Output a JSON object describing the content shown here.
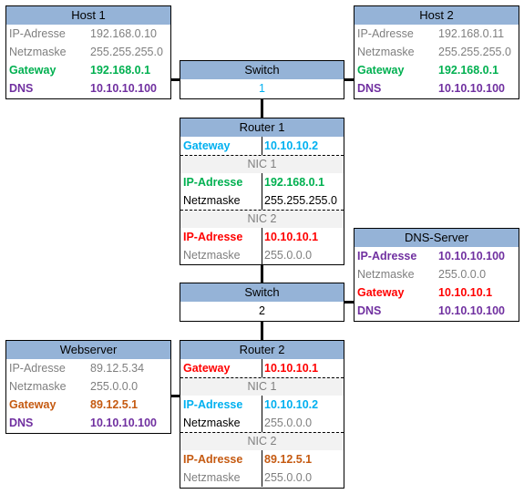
{
  "colors": {
    "gray": "#7f7f7f",
    "black": "#000000",
    "green": "#00b050",
    "purple": "#7030a0",
    "blue": "#00b0f0",
    "red": "#ff0000",
    "orange": "#c55a11",
    "header": "#95b3d7"
  },
  "hosts": [
    {
      "id": "host1",
      "title": "Host 1",
      "rows": [
        {
          "label": "IP-Adresse",
          "value": "192.168.0.10",
          "color": "gray",
          "bold": false
        },
        {
          "label": "Netzmaske",
          "value": "255.255.255.0",
          "color": "gray",
          "bold": false
        },
        {
          "label": "Gateway",
          "value": "192.168.0.1",
          "color": "green",
          "bold": true
        },
        {
          "label": "DNS",
          "value": "10.10.10.100",
          "color": "purple",
          "bold": true
        }
      ]
    },
    {
      "id": "host2",
      "title": "Host 2",
      "rows": [
        {
          "label": "IP-Adresse",
          "value": "192.168.0.11",
          "color": "gray",
          "bold": false
        },
        {
          "label": "Netzmaske",
          "value": "255.255.255.0",
          "color": "gray",
          "bold": false
        },
        {
          "label": "Gateway",
          "value": "192.168.0.1",
          "color": "green",
          "bold": true
        },
        {
          "label": "DNS",
          "value": "10.10.10.100",
          "color": "purple",
          "bold": true
        }
      ]
    },
    {
      "id": "dns",
      "title": "DNS-Server",
      "rows": [
        {
          "label": "IP-Adresse",
          "value": "10.10.10.100",
          "color": "purple",
          "bold": true
        },
        {
          "label": "Netzmaske",
          "value": "255.0.0.0",
          "color": "gray",
          "bold": false
        },
        {
          "label": "Gateway",
          "value": "10.10.10.1",
          "color": "red",
          "bold": true
        },
        {
          "label": "DNS",
          "value": "10.10.10.100",
          "color": "purple",
          "bold": true
        }
      ]
    },
    {
      "id": "web",
      "title": "Webserver",
      "rows": [
        {
          "label": "IP-Adresse",
          "value": "89.12.5.34",
          "color": "gray",
          "bold": false
        },
        {
          "label": "Netzmaske",
          "value": "255.0.0.0",
          "color": "gray",
          "bold": false
        },
        {
          "label": "Gateway",
          "value": "89.12.5.1",
          "color": "orange",
          "bold": true
        },
        {
          "label": "DNS",
          "value": "10.10.10.100",
          "color": "purple",
          "bold": true
        }
      ]
    }
  ],
  "switches": [
    {
      "id": "switch1",
      "title": "Switch",
      "value": "1",
      "color": "blue"
    },
    {
      "id": "switch2",
      "title": "Switch",
      "value": "2",
      "color": "black"
    }
  ],
  "routers": [
    {
      "id": "router1",
      "title": "Router 1",
      "rows": [
        {
          "label": "Gateway",
          "value": "10.10.10.2",
          "color": "blue",
          "bold": true
        },
        {
          "nic": "NIC 1"
        },
        {
          "label": "IP-Adresse",
          "value": "192.168.0.1",
          "color": "green",
          "bold": true
        },
        {
          "label": "Netzmaske",
          "value": "255.255.255.0",
          "color": "black",
          "bold": false
        },
        {
          "nic": "NIC 2"
        },
        {
          "label": "IP-Adresse",
          "value": "10.10.10.1",
          "color": "red",
          "bold": true
        },
        {
          "label": "Netzmaske",
          "value": "255.0.0.0",
          "color": "gray",
          "bold": false
        }
      ]
    },
    {
      "id": "router2",
      "title": "Router 2",
      "rows": [
        {
          "label": "Gateway",
          "value": "10.10.10.1",
          "color": "red",
          "bold": true
        },
        {
          "nic": "NIC 1"
        },
        {
          "label": "IP-Adresse",
          "value": "10.10.10.2",
          "color": "blue",
          "bold": true
        },
        {
          "label": "Netzmaske",
          "value": "255.0.0.0",
          "color": "black",
          "valueColor": "gray",
          "bold": false
        },
        {
          "nic": "NIC 2"
        },
        {
          "label": "IP-Adresse",
          "value": "89.12.5.1",
          "color": "orange",
          "bold": true
        },
        {
          "label": "Netzmaske",
          "value": "255.0.0.0",
          "color": "gray",
          "bold": false
        }
      ]
    }
  ]
}
